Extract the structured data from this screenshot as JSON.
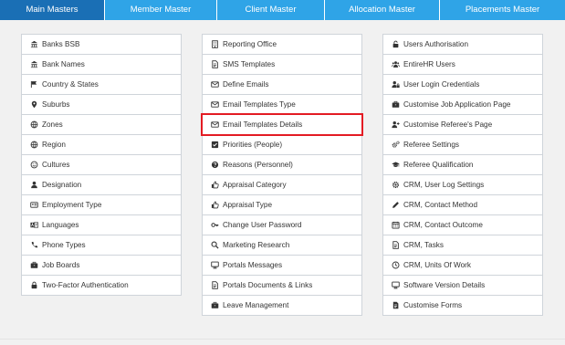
{
  "tabs": [
    {
      "label": "Main Masters",
      "active": true
    },
    {
      "label": "Member Master",
      "active": false
    },
    {
      "label": "Client Master",
      "active": false
    },
    {
      "label": "Allocation Master",
      "active": false
    },
    {
      "label": "Placements Master",
      "active": false
    }
  ],
  "columns": [
    [
      {
        "label": "Banks BSB",
        "icon": "bank-icon"
      },
      {
        "label": "Bank Names",
        "icon": "bank-icon"
      },
      {
        "label": "Country & States",
        "icon": "flag-icon"
      },
      {
        "label": "Suburbs",
        "icon": "map-marker-icon"
      },
      {
        "label": "Zones",
        "icon": "globe-icon"
      },
      {
        "label": "Region",
        "icon": "globe-icon"
      },
      {
        "label": "Cultures",
        "icon": "smile-icon"
      },
      {
        "label": "Designation",
        "icon": "user-icon"
      },
      {
        "label": "Employment Type",
        "icon": "card-icon"
      },
      {
        "label": "Languages",
        "icon": "language-icon"
      },
      {
        "label": "Phone Types",
        "icon": "phone-icon"
      },
      {
        "label": "Job Boards",
        "icon": "briefcase-icon"
      },
      {
        "label": "Two-Factor Authentication",
        "icon": "lock-icon"
      }
    ],
    [
      {
        "label": "Reporting Office",
        "icon": "building-icon"
      },
      {
        "label": "SMS Templates",
        "icon": "file-icon"
      },
      {
        "label": "Define Emails",
        "icon": "envelope-icon"
      },
      {
        "label": "Email Templates Type",
        "icon": "envelope-icon"
      },
      {
        "label": "Email Templates Details",
        "icon": "envelope-icon",
        "highlight": true
      },
      {
        "label": "Priorities (People)",
        "icon": "check-square-icon"
      },
      {
        "label": "Reasons (Personnel)",
        "icon": "question-circle-icon"
      },
      {
        "label": "Appraisal Category",
        "icon": "thumbs-up-icon"
      },
      {
        "label": "Appraisal Type",
        "icon": "thumbs-up-icon"
      },
      {
        "label": "Change User Password",
        "icon": "key-icon"
      },
      {
        "label": "Marketing Research",
        "icon": "search-icon"
      },
      {
        "label": "Portals Messages",
        "icon": "desktop-icon"
      },
      {
        "label": "Portals Documents & Links",
        "icon": "file-icon"
      },
      {
        "label": "Leave Management",
        "icon": "briefcase-icon"
      }
    ],
    [
      {
        "label": "Users Authorisation",
        "icon": "unlock-icon"
      },
      {
        "label": "EntireHR Users",
        "icon": "users-icon"
      },
      {
        "label": "User Login Credentials",
        "icon": "user-lock-icon"
      },
      {
        "label": "Customise Job Application Page",
        "icon": "briefcase-icon"
      },
      {
        "label": "Customise Referee's Page",
        "icon": "user-plus-icon"
      },
      {
        "label": "Referee Settings",
        "icon": "cogs-icon"
      },
      {
        "label": "Referee Qualification",
        "icon": "graduation-cap-icon"
      },
      {
        "label": "CRM, User Log Settings",
        "icon": "cog-icon"
      },
      {
        "label": "CRM, Contact Method",
        "icon": "pencil-icon"
      },
      {
        "label": "CRM, Contact Outcome",
        "icon": "calendar-icon"
      },
      {
        "label": "CRM, Tasks",
        "icon": "file-icon"
      },
      {
        "label": "CRM, Units Of Work",
        "icon": "clock-icon"
      },
      {
        "label": "Software Version Details",
        "icon": "desktop-icon"
      },
      {
        "label": "Customise Forms",
        "icon": "file-text-icon"
      }
    ]
  ]
}
